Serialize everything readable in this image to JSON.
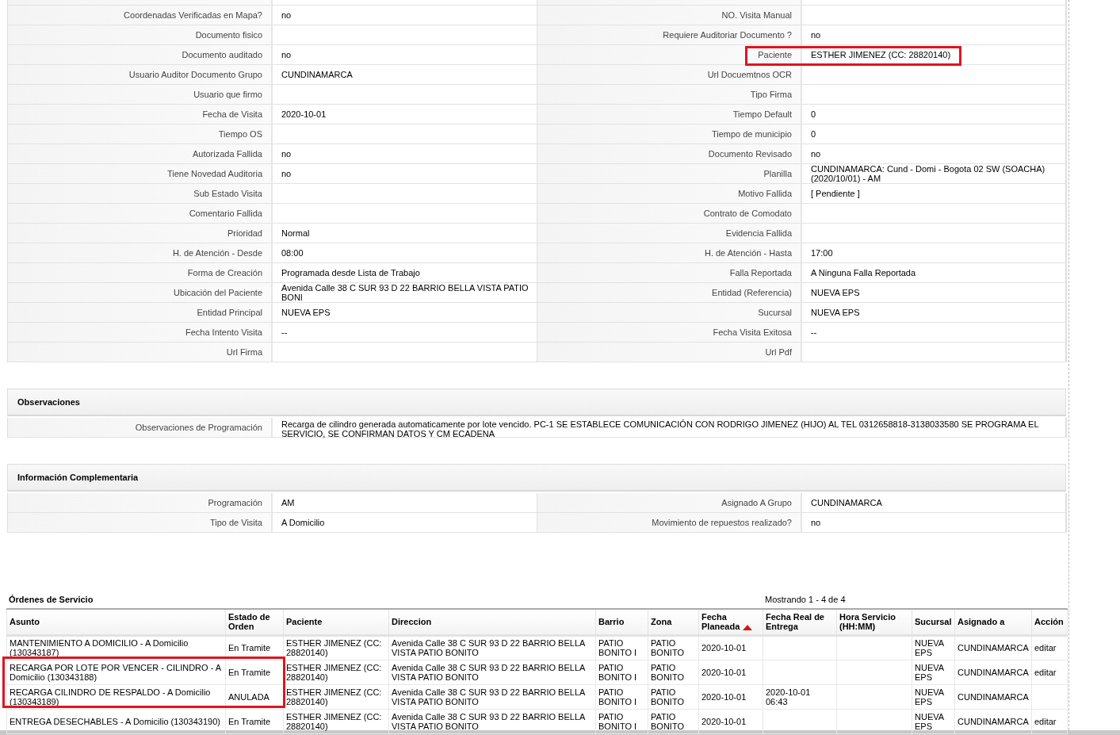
{
  "details": {
    "fields": [
      {
        "label": "Coordenadas Verificadas en Mapa?",
        "value": "no",
        "highlighted": false
      },
      {
        "label": "NO. Visita Manual",
        "highlighted": false
      },
      {
        "label": "Documento fisico",
        "highlighted": false
      },
      {
        "label": "Requiere Auditoriar Documento ?",
        "value": "no",
        "highlighted": false
      },
      {
        "label": "Documento auditado",
        "value": "no",
        "highlighted": false
      },
      {
        "label": "Paciente",
        "value": "ESTHER JIMENEZ (CC: 28820140)",
        "highlighted": true
      },
      {
        "label": "Usuario Auditor Documento Grupo",
        "value": "CUNDINAMARCA",
        "highlighted": false
      },
      {
        "label": "Url Docuemtnos OCR",
        "highlighted": false
      },
      {
        "label": "Usuario que firmo",
        "highlighted": false
      },
      {
        "label": "Tipo Firma",
        "highlighted": false
      },
      {
        "label": "Fecha de Visita",
        "value": "2020-10-01",
        "highlighted": false
      },
      {
        "label": "Tiempo Default",
        "value": "0",
        "highlighted": false
      },
      {
        "label": "Tiempo OS",
        "highlighted": false
      },
      {
        "label": "Tiempo de municipio",
        "value": "0",
        "highlighted": false
      },
      {
        "label": "Autorizada Fallida",
        "value": "no",
        "highlighted": false
      },
      {
        "label": "Documento Revisado",
        "value": "no",
        "highlighted": false
      },
      {
        "label": "Tiene Novedad Auditoria",
        "value": "no",
        "highlighted": false
      },
      {
        "label": "Planilla",
        "value": "CUNDINAMARCA: Cund - Domi - Bogota 02 SW (SOACHA) (2020/10/01) - AM",
        "highlighted": false
      },
      {
        "label": "Sub Estado Visita",
        "highlighted": false
      },
      {
        "label": "Motivo Fallida",
        "value": "[ Pendiente ]",
        "highlighted": false
      },
      {
        "label": "Comentario Fallida",
        "highlighted": false
      },
      {
        "label": "Contrato de Comodato",
        "highlighted": false
      },
      {
        "label": "Prioridad",
        "value": "Normal",
        "highlighted": false
      },
      {
        "label": "Evidencia Fallida",
        "highlighted": false
      },
      {
        "label": "H. de Atención - Desde",
        "value": "08:00",
        "highlighted": false
      },
      {
        "label": "H. de Atención - Hasta",
        "value": "17:00",
        "highlighted": false
      },
      {
        "label": "Forma de Creación",
        "value": "Programada desde Lista de Trabajo",
        "highlighted": false
      },
      {
        "label": "Falla Reportada",
        "value": "A Ninguna Falla Reportada",
        "highlighted": false
      },
      {
        "label": "Ubicación del Paciente",
        "value": "Avenida Calle 38 C SUR 93 D 22 BARRIO BELLA VISTA PATIO BONI",
        "highlighted": false
      },
      {
        "label": "Entidad (Referencia)",
        "value": "NUEVA EPS",
        "highlighted": false
      },
      {
        "label": "Entidad Principal",
        "value": "NUEVA EPS",
        "highlighted": false
      },
      {
        "label": "Sucursal",
        "value": "NUEVA EPS",
        "highlighted": false
      },
      {
        "label": "Fecha Intento Visita",
        "value": "--",
        "highlighted": false
      },
      {
        "label": "Fecha Visita Exitosa",
        "value": "--",
        "highlighted": false
      },
      {
        "label": "Url Firma",
        "highlighted": false
      },
      {
        "label": "Url Pdf",
        "highlighted": false
      }
    ]
  },
  "observaciones": {
    "title": "Observaciones",
    "fields": [
      {
        "label": "Observaciones de Programación",
        "value": "Recarga de cilindro generada automaticamente por lote vencido. PC-1 SE ESTABLECE COMUNICACIÓN CON RODRIGO JIMENEZ (HIJO) AL TEL 0312658818-3138033580 SE PROGRAMA EL SERVICIO, SE CONFIRMAN DATOS Y CM ECADENA",
        "highlighted": false
      }
    ]
  },
  "informacion_complementaria": {
    "title": "Información Complementaria",
    "fields": [
      {
        "label": "Programación",
        "value": "AM",
        "highlighted": false
      },
      {
        "label": "Asignado A Grupo",
        "value": "CUNDINAMARCA",
        "highlighted": false
      },
      {
        "label": "Tipo de Visita",
        "value": "A Domicilio",
        "highlighted": false
      },
      {
        "label": "Movimiento de repuestos realizado?",
        "value": "no",
        "highlighted": false
      }
    ]
  },
  "ordenes": {
    "title": "Órdenes de Servicio",
    "pagination": "Mostrando 1 - 4 de 4",
    "columns": [
      {
        "label": "Asunto",
        "sorted": false
      },
      {
        "label": "Estado de Orden",
        "sorted": false
      },
      {
        "label": "Paciente",
        "sorted": false
      },
      {
        "label": "Direccion",
        "sorted": false
      },
      {
        "label": "Barrio",
        "sorted": false
      },
      {
        "label": "Zona",
        "sorted": false
      },
      {
        "label": "Fecha Planeada",
        "sorted": true
      },
      {
        "label": "Fecha Real de Entrega",
        "sorted": false
      },
      {
        "label": "Hora Servicio (HH:MM)",
        "sorted": false
      },
      {
        "label": "Sucursal",
        "sorted": false
      },
      {
        "label": "Asignado a",
        "sorted": false
      },
      {
        "label": "Acción",
        "sorted": false
      }
    ],
    "rows": [
      {
        "asunto": "MANTENIMIENTO A DOMICILIO - A Domicilio (130343187)",
        "estado": "En Tramite",
        "paciente": "ESTHER JIMENEZ (CC: 28820140)",
        "direccion": "Avenida Calle 38 C SUR 93 D 22 BARRIO BELLA VISTA PATIO BONITO",
        "barrio": "PATIO BONITO I",
        "zona": "PATIO BONITO",
        "fecha_planeada": "2020-10-01",
        "sucursal": "NUEVA EPS",
        "asignado": "CUNDINAMARCA",
        "accion": "editar",
        "highlighted": false
      },
      {
        "asunto": "RECARGA POR LOTE POR VENCER - CILINDRO - A Domicilio (130343188)",
        "estado": "En Tramite",
        "paciente": "ESTHER JIMENEZ (CC: 28820140)",
        "direccion": "Avenida Calle 38 C SUR 93 D 22 BARRIO BELLA VISTA PATIO BONITO",
        "barrio": "PATIO BONITO I",
        "zona": "PATIO BONITO",
        "fecha_planeada": "2020-10-01",
        "sucursal": "NUEVA EPS",
        "asignado": "CUNDINAMARCA",
        "accion": "editar",
        "highlighted": true
      },
      {
        "asunto": "RECARGA CILINDRO DE RESPALDO - A Domicilio (130343189)",
        "estado": "ANULADA",
        "paciente": "ESTHER JIMENEZ (CC: 28820140)",
        "direccion": "Avenida Calle 38 C SUR 93 D 22 BARRIO BELLA VISTA PATIO BONITO",
        "barrio": "PATIO BONITO I",
        "zona": "PATIO BONITO",
        "fecha_planeada": "2020-10-01",
        "fecha_real": "2020-10-01 06:43",
        "sucursal": "NUEVA EPS",
        "asignado": "CUNDINAMARCA",
        "highlighted": true
      },
      {
        "asunto": "ENTREGA DESECHABLES - A Domicilio (130343190)",
        "estado": "En Tramite",
        "paciente": "ESTHER JIMENEZ (CC: 28820140)",
        "direccion": "Avenida Calle 38 C SUR 93 D 22 BARRIO BELLA VISTA PATIO BONITO",
        "barrio": "PATIO BONITO I",
        "zona": "PATIO BONITO",
        "fecha_planeada": "2020-10-01",
        "sucursal": "NUEVA EPS",
        "asignado": "CUNDINAMARCA",
        "accion": "editar",
        "highlighted": false
      }
    ]
  }
}
